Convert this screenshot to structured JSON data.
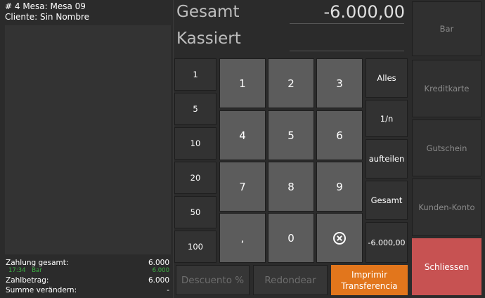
{
  "order": {
    "title": "# 4 Mesa: Mesa 09",
    "client": "Cliente: Sin Nombre"
  },
  "summary": {
    "zahlung_gesamt_label": "Zahlung gesamt:",
    "zahlung_gesamt_value": "6.000",
    "payment_time": "17:34",
    "payment_method": "Bar",
    "payment_amount": "6.000",
    "zahlbetrag_label": "Zahlbetrag:",
    "zahlbetrag_value": "6.000",
    "summe_label": "Summe verändern:",
    "summe_value": "-"
  },
  "display": {
    "gesamt_label": "Gesamt",
    "gesamt_value": "-6.000,00",
    "kassiert_label": "Kassiert"
  },
  "quick_amounts": [
    "1",
    "5",
    "10",
    "20",
    "50",
    "100"
  ],
  "keypad": [
    "1",
    "2",
    "3",
    "4",
    "5",
    "6",
    "7",
    "8",
    "9",
    ",",
    "0"
  ],
  "side_buttons": {
    "alles": "Alles",
    "one_n": "1/n",
    "aufteilen": "aufteilen",
    "gesamt": "Gesamt",
    "amount": "-6.000,00"
  },
  "payment_methods": {
    "bar": "Bar",
    "kreditkarte": "Kreditkarte",
    "gutschein": "Gutschein",
    "kunden_konto": "Kunden-Konto"
  },
  "bottom_buttons": {
    "descuento": "Descuento %",
    "redondear": "Redondear",
    "imprimir_line1": "Imprimir",
    "imprimir_line2": "Transferencia"
  },
  "close_label": "Schliessen",
  "colors": {
    "accent_orange": "#e2761c",
    "close_red": "#c75252",
    "payment_green": "#3cb043"
  }
}
